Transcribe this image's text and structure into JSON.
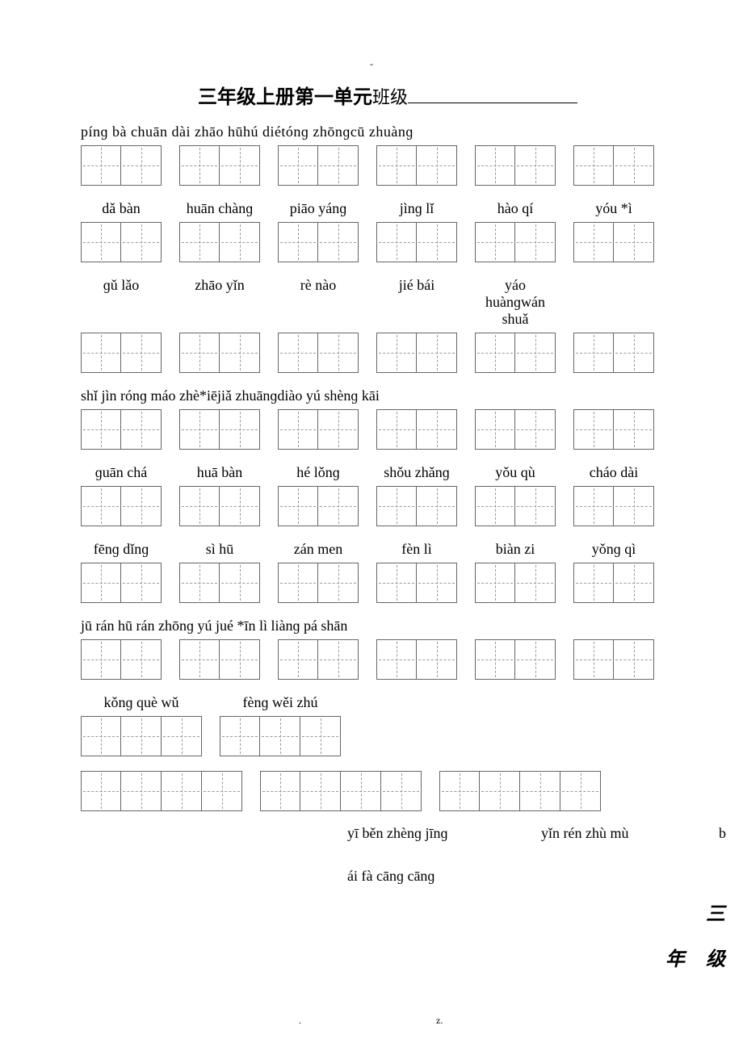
{
  "top_dash": "-",
  "title": {
    "bold": "三年级上册第一单元",
    "thin": "班级"
  },
  "rows": [
    {
      "pinyin": "pínɡ bà chuān dài zhāo hūhú  diétónɡ  zhōnɡcū  zhuànɡ",
      "groups": [
        2,
        2,
        2,
        2,
        2,
        2
      ]
    },
    {
      "pinyin_items": [
        "dǎ  bàn",
        "huān chànɡ",
        "piāo yánɡ",
        "jìnɡ  lǐ",
        "hào qí",
        "yóu *ì"
      ],
      "groups": [
        2,
        2,
        2,
        2,
        2,
        2
      ]
    },
    {
      "pinyin_items": [
        "ɡǔ  lǎo",
        "zhāo yǐn",
        "rè  nào",
        "jié  bái",
        "yáo huànɡwán shuǎ"
      ],
      "groups": [
        2,
        2,
        2,
        2,
        2,
        2
      ]
    },
    {
      "pinyin": "shǐ  jìn rónɡ  máo zhè*iējiǎ  zhuānɡdiào yú shènɡ  kāi",
      "groups": [
        2,
        2,
        2,
        2,
        2,
        2
      ]
    },
    {
      "pinyin_items": [
        "ɡuān chá",
        "huā  bàn",
        "hé  lǒnɡ",
        "shǒu zhǎnɡ",
        "yǒu qù",
        "cháo dài"
      ],
      "groups": [
        2,
        2,
        2,
        2,
        2,
        2
      ]
    },
    {
      "pinyin_items": [
        "fēnɡ  dǐnɡ",
        "sì  hū",
        "zán men",
        "fèn lì",
        "biàn zi",
        "yǒnɡ qì"
      ],
      "groups": [
        2,
        2,
        2,
        2,
        2,
        2
      ]
    },
    {
      "pinyin": "jū  rán     hū rán zhōnɡ  yú jué *īn lì liànɡ  pá   shān",
      "groups": [
        2,
        2,
        2,
        2,
        2,
        2
      ]
    },
    {
      "pinyin_items": [
        "kǒnɡ què wǔ",
        "fènɡ wěi zhú"
      ],
      "groups": [
        3,
        3
      ]
    },
    {
      "groups": [
        4,
        4,
        4
      ]
    }
  ],
  "row8_extra": {
    "line1a": "yī běn zhènɡ  jīnɡ",
    "line1b": "yǐn rén zhù  mù",
    "line1c": "b",
    "line2": "ái fà  cānɡ  cānɡ"
  },
  "footer_cn": {
    "san": "三",
    "nian": "年",
    "ji": "级"
  },
  "botmarks": {
    "dot": ".",
    "z": "z."
  }
}
